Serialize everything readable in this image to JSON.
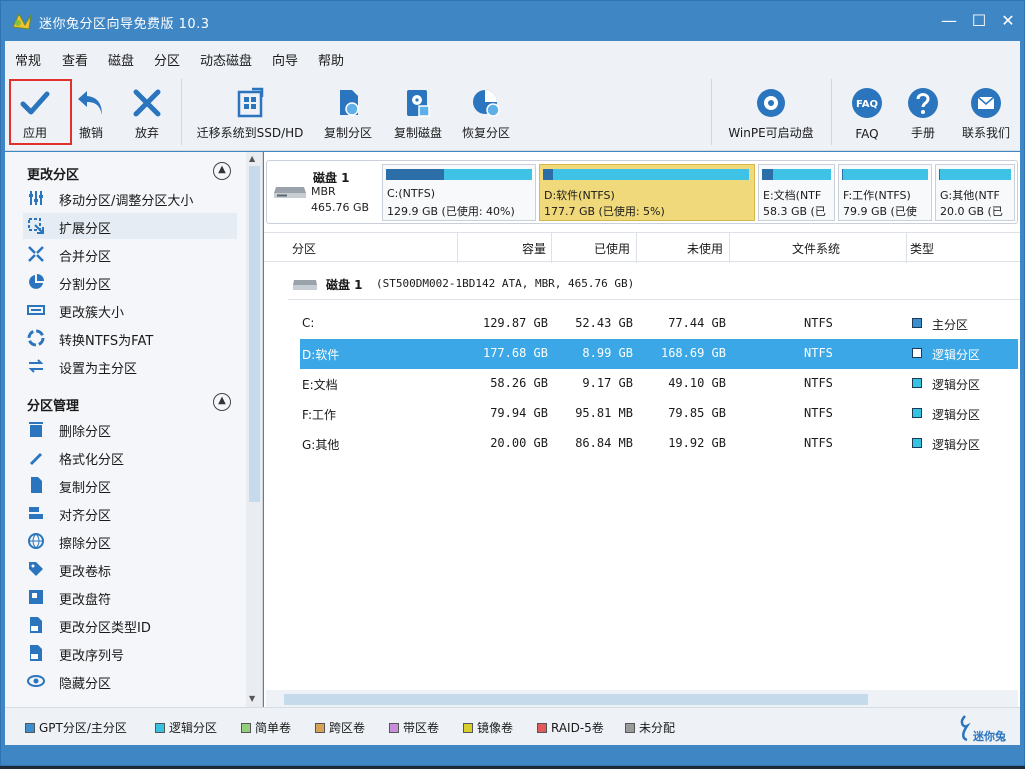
{
  "title": "迷你兔分区向导免费版 10.3",
  "menu": [
    "常规",
    "查看",
    "磁盘",
    "分区",
    "动态磁盘",
    "向导",
    "帮助"
  ],
  "toolbar": {
    "apply": "应用",
    "undo": "撤销",
    "discard": "放弃",
    "migrate": "迁移系统到SSD/HD",
    "copy_part": "复制分区",
    "copy_disk": "复制磁盘",
    "recover": "恢复分区",
    "winpe": "WinPE可启动盘",
    "faq": "FAQ",
    "manual": "手册",
    "contact": "联系我们",
    "faq_icon_text": "FAQ"
  },
  "sidebar": {
    "section1": "更改分区",
    "items1": [
      "移动分区/调整分区大小",
      "扩展分区",
      "合并分区",
      "分割分区",
      "更改簇大小",
      "转换NTFS为FAT",
      "设置为主分区"
    ],
    "section2": "分区管理",
    "items2": [
      "删除分区",
      "格式化分区",
      "复制分区",
      "对齐分区",
      "擦除分区",
      "更改卷标",
      "更改盘符",
      "更改分区类型ID",
      "更改序列号",
      "隐藏分区"
    ]
  },
  "disk_map": {
    "name": "磁盘 1",
    "scheme": "MBR",
    "size": "465.76 GB",
    "parts": [
      {
        "l1": "C:(NTFS)",
        "l2": "129.9 GB (已使用: 40%)",
        "used_pct": 40
      },
      {
        "l1": "D:软件(NTFS)",
        "l2": "177.7 GB (已使用: 5%)",
        "used_pct": 5
      },
      {
        "l1": "E:文档(NTF",
        "l2": "58.3 GB (已",
        "used_pct": 16
      },
      {
        "l1": "F:工作(NTFS)",
        "l2": "79.9 GB (已使",
        "used_pct": 1
      },
      {
        "l1": "G:其他(NTF",
        "l2": "20.0 GB (已",
        "used_pct": 1
      }
    ]
  },
  "grid": {
    "headers": [
      "分区",
      "容量",
      "已使用",
      "未使用",
      "文件系统",
      "类型"
    ],
    "disk_label": "磁盘 1",
    "disk_desc": "(ST500DM002-1BD142 ATA, MBR, 465.76 GB)",
    "rows": [
      {
        "name": "C:",
        "cap": "129.87 GB",
        "used": "52.43 GB",
        "free": "77.44 GB",
        "fs": "NTFS",
        "type": "主分区"
      },
      {
        "name": "D:软件",
        "cap": "177.68 GB",
        "used": "8.99 GB",
        "free": "168.69 GB",
        "fs": "NTFS",
        "type": "逻辑分区"
      },
      {
        "name": "E:文档",
        "cap": "58.26 GB",
        "used": "9.17 GB",
        "free": "49.10 GB",
        "fs": "NTFS",
        "type": "逻辑分区"
      },
      {
        "name": "F:工作",
        "cap": "79.94 GB",
        "used": "95.81 MB",
        "free": "79.85 GB",
        "fs": "NTFS",
        "type": "逻辑分区"
      },
      {
        "name": "G:其他",
        "cap": "20.00 GB",
        "used": "86.84 MB",
        "free": "19.92 GB",
        "fs": "NTFS",
        "type": "逻辑分区"
      }
    ]
  },
  "legend": [
    "GPT分区/主分区",
    "逻辑分区",
    "简单卷",
    "跨区卷",
    "带区卷",
    "镜像卷",
    "RAID-5卷",
    "未分配"
  ],
  "legend_colors": [
    "#3a8fd0",
    "#36c3e0",
    "#93d07d",
    "#d5a45a",
    "#c78fd8",
    "#d8cf2c",
    "#e35a5a",
    "#9a9a9a"
  ],
  "brand": "迷你兔",
  "colors": {
    "accent": "#3f86c5",
    "selection": "#3ba7e6",
    "selected_block": "#f0d97a"
  }
}
